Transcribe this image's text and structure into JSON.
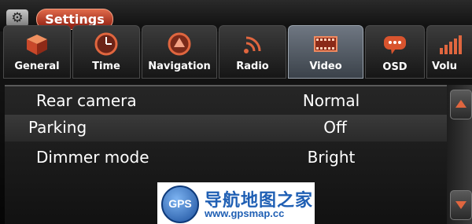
{
  "header": {
    "title": "Settings",
    "icon": "gear-icon"
  },
  "tabs": [
    {
      "label": "General",
      "icon": "cube-icon"
    },
    {
      "label": "Time",
      "icon": "clock-icon"
    },
    {
      "label": "Navigation",
      "icon": "navigation-icon"
    },
    {
      "label": "Radio",
      "icon": "radio-waves-icon"
    },
    {
      "label": "Video",
      "icon": "film-icon",
      "active": true
    },
    {
      "label": "OSD",
      "icon": "speech-bubble-icon"
    },
    {
      "label": "Volu",
      "icon": "volume-bars-icon"
    }
  ],
  "settings": [
    {
      "name": "Rear camera",
      "value": "Normal"
    },
    {
      "name": "Parking",
      "value": "Off"
    },
    {
      "name": "Dimmer mode",
      "value": "Bright"
    }
  ],
  "watermark": {
    "logo_text": "GPS",
    "title": "导航地图之家",
    "url": "www.gpsmap.cc"
  },
  "colors": {
    "accent": "#c0391f",
    "active_tab": "#5d6670",
    "watermark": "#1f5fb4"
  }
}
